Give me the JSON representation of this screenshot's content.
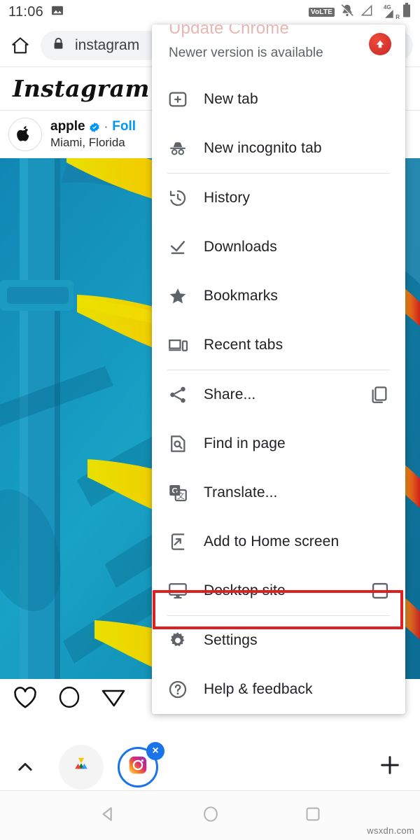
{
  "statusbar": {
    "time": "11:06",
    "icons": [
      "image-icon",
      "volte-icon",
      "notifications-muted-icon",
      "signal-icon",
      "signal-roaming-icon",
      "battery-icon"
    ],
    "volte_label": "VoLTE",
    "network_label": "4G",
    "roaming_label": "R"
  },
  "browser": {
    "home_icon": "home-icon",
    "lock_icon": "lock-icon",
    "url": "instagram"
  },
  "instagram": {
    "logo": "Instagram",
    "username": "apple",
    "separator": "·",
    "follow_label": "Foll",
    "location": "Miami, Florida",
    "actions": [
      "like-heart-icon",
      "comment-icon",
      "share-paperplane-icon"
    ]
  },
  "menu": {
    "update": {
      "title": "Update Chrome",
      "subtitle": "Newer version is available",
      "badge_icon": "update-arrow-icon"
    },
    "items": [
      {
        "id": "new-tab",
        "label": "New tab",
        "icon": "new-tab-icon",
        "trailing": null,
        "separator_after": false
      },
      {
        "id": "new-incognito-tab",
        "label": "New incognito tab",
        "icon": "incognito-icon",
        "trailing": null,
        "separator_after": true
      },
      {
        "id": "history",
        "label": "History",
        "icon": "history-icon",
        "trailing": null,
        "separator_after": false
      },
      {
        "id": "downloads",
        "label": "Downloads",
        "icon": "downloads-icon",
        "trailing": null,
        "separator_after": false
      },
      {
        "id": "bookmarks",
        "label": "Bookmarks",
        "icon": "bookmark-star-icon",
        "trailing": null,
        "separator_after": false
      },
      {
        "id": "recent-tabs",
        "label": "Recent tabs",
        "icon": "recent-tabs-icon",
        "trailing": null,
        "separator_after": true
      },
      {
        "id": "share",
        "label": "Share...",
        "icon": "share-icon",
        "trailing": "copy-icon",
        "separator_after": false
      },
      {
        "id": "find-in-page",
        "label": "Find in page",
        "icon": "find-in-page-icon",
        "trailing": null,
        "separator_after": false
      },
      {
        "id": "translate",
        "label": "Translate...",
        "icon": "translate-icon",
        "trailing": null,
        "separator_after": false
      },
      {
        "id": "add-to-home",
        "label": "Add to Home screen",
        "icon": "add-to-home-icon",
        "trailing": null,
        "separator_after": false
      },
      {
        "id": "desktop-site",
        "label": "Desktop site",
        "icon": "desktop-icon",
        "trailing": "checkbox-unchecked",
        "separator_after": true
      },
      {
        "id": "settings",
        "label": "Settings",
        "icon": "gear-icon",
        "trailing": null,
        "separator_after": false
      },
      {
        "id": "help-feedback",
        "label": "Help & feedback",
        "icon": "help-circle-icon",
        "trailing": null,
        "separator_after": false
      }
    ],
    "highlight": {
      "target": "desktop-site",
      "color": "#e02020"
    }
  },
  "dock": {
    "chevron_icon": "chevron-up-icon",
    "apps": [
      {
        "id": "drive-app",
        "icon": "google-drive-icon",
        "closable": false
      },
      {
        "id": "instagram-app",
        "icon": "instagram-icon",
        "closable": true,
        "close_label": "×"
      }
    ],
    "add_icon": "plus-icon"
  },
  "navbar": {
    "back_icon": "triangle-back-icon",
    "home_icon": "circle-home-icon",
    "recents_icon": "square-recents-icon"
  },
  "watermark": "wsxdn.com",
  "colors": {
    "accent_blue": "#0095f6",
    "highlight_red": "#e02020",
    "chrome_update_red": "#c62828",
    "menu_text": "#202124",
    "icon_gray": "#5f6368"
  }
}
